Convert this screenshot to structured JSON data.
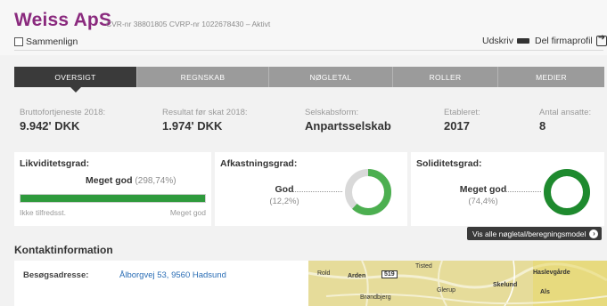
{
  "company": {
    "name": "Weiss ApS",
    "meta": "CVR-nr 38801805 CVRP-nr 1022678430 – Aktivt",
    "compare_label": "Sammenlign",
    "print_label": "Udskriv",
    "share_label": "Del firmaprofil"
  },
  "tabs": [
    {
      "label": "OVERSIGT",
      "active": true
    },
    {
      "label": "REGNSKAB",
      "active": false
    },
    {
      "label": "NØGLETAL",
      "active": false
    },
    {
      "label": "ROLLER",
      "active": false
    },
    {
      "label": "MEDIER",
      "active": false
    }
  ],
  "key_figures": [
    {
      "label": "Bruttofortjeneste 2018:",
      "value": "9.942' DKK"
    },
    {
      "label": "Resultat før skat 2018:",
      "value": "1.974' DKK"
    },
    {
      "label": "Selskabsform:",
      "value": "Anpartsselskab"
    },
    {
      "label": "Etableret:",
      "value": "2017"
    },
    {
      "label": "Antal ansatte:",
      "value": "8"
    }
  ],
  "ratios": {
    "liquidity": {
      "title": "Likviditetsgrad:",
      "rating": "Meget god",
      "pct": "(298,74%)",
      "fill": 1.0,
      "low_label": "Ikke tilfredsst.",
      "high_label": "Meget god"
    },
    "return": {
      "title": "Afkastningsgrad:",
      "rating": "God",
      "pct": "(12,2%)",
      "fraction": 0.62
    },
    "solidity": {
      "title": "Soliditetsgrad:",
      "rating": "Meget god",
      "pct": "(74,4%)",
      "fraction": 1.0
    },
    "all_link": "Vis alle nøgletal/beregningsmodel"
  },
  "colors": {
    "brand": "#8a2a7e",
    "good": "#4caf50",
    "very_good": "#1e8a2e",
    "track": "#d9d9d9",
    "tab_active": "#3a3a3a",
    "tab_inactive": "#9b9b9b",
    "link": "#2a6db5"
  },
  "contact": {
    "title": "Kontaktinformation",
    "address_label": "Besøgsadresse:",
    "address_value": "Ålborgvej 53, 9560 Hadsund"
  },
  "map": {
    "labels": [
      "Rold",
      "Arden",
      "519",
      "Tisted",
      "Haslevgårde",
      "Skelund",
      "Glerup",
      "Als",
      "Brøndbjerg"
    ]
  }
}
